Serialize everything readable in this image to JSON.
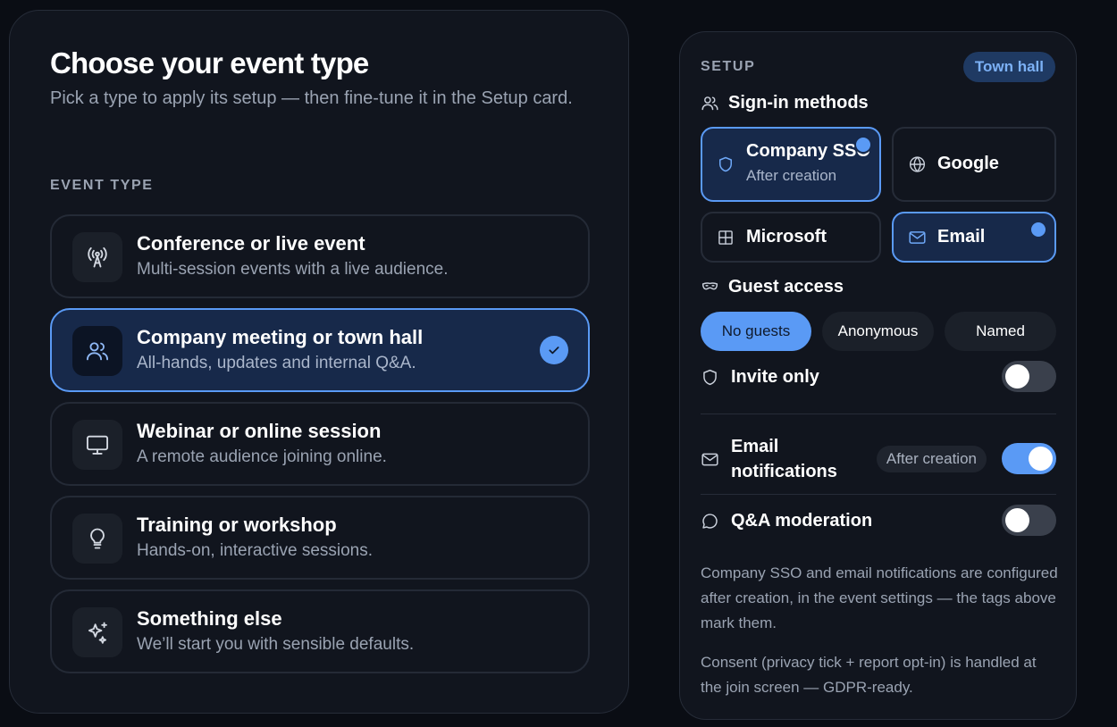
{
  "left": {
    "title": "Choose your event type",
    "subtitle": "Pick a type to apply its setup — then fine-tune it in the Setup card.",
    "section_label": "EVENT TYPE",
    "types": [
      {
        "title": "Conference or live event",
        "desc": "Multi-session events with a live audience.",
        "icon": "broadcast-icon",
        "selected": false
      },
      {
        "title": "Company meeting or town hall",
        "desc": "All-hands, updates and internal Q&A.",
        "icon": "users-icon",
        "selected": true
      },
      {
        "title": "Webinar or online session",
        "desc": "A remote audience joining online.",
        "icon": "monitor-icon",
        "selected": false
      },
      {
        "title": "Training or workshop",
        "desc": "Hands-on, interactive sessions.",
        "icon": "lightbulb-icon",
        "selected": false
      },
      {
        "title": "Something else",
        "desc": "We’ll start you with sensible defaults.",
        "icon": "sparkles-icon",
        "selected": false
      }
    ]
  },
  "setup": {
    "label": "SETUP",
    "badge": "Town hall",
    "sign_in_heading": "Sign-in methods",
    "methods": [
      {
        "label": "Company SSO",
        "sub": "After creation",
        "icon": "shield-icon",
        "active": true
      },
      {
        "label": "Google",
        "icon": "globe-icon",
        "active": false
      },
      {
        "label": "Microsoft",
        "icon": "grid-icon",
        "active": false
      },
      {
        "label": "Email",
        "icon": "mail-icon",
        "active": true
      }
    ],
    "guest_heading": "Guest access",
    "guest_options": [
      {
        "label": "No guests",
        "active": true
      },
      {
        "label": "Anonymous",
        "active": false
      },
      {
        "label": "Named",
        "active": false
      }
    ],
    "invite_only": {
      "label": "Invite only",
      "on": false,
      "icon": "shield-icon"
    },
    "email_notifications": {
      "label": "Email notifications",
      "tag": "After creation",
      "on": true,
      "icon": "mail-icon"
    },
    "qa_moderation": {
      "label": "Q&A moderation",
      "on": false,
      "icon": "chat-bubble-icon"
    },
    "note_1": "Company SSO and email notifications are configured after creation, in the event settings — the tags above mark them.",
    "note_2": "Consent (privacy tick + report opt-in) is handled at the join screen — GDPR-ready."
  },
  "colors": {
    "accent": "#5a9af5",
    "background": "#0a0d14",
    "card": "#11151e",
    "selected_fill": "#17294a"
  }
}
